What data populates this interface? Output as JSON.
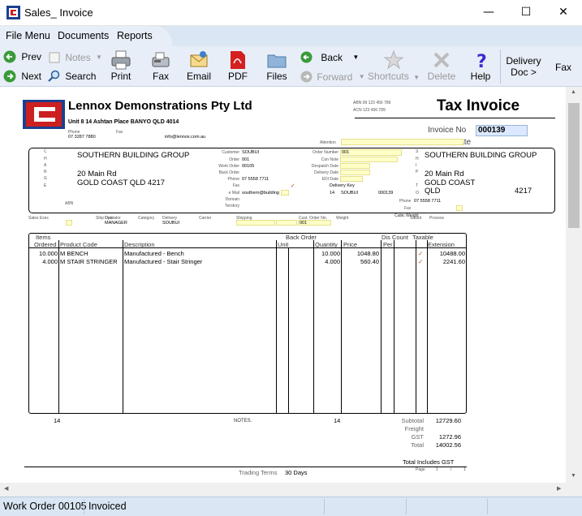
{
  "window": {
    "title": "Sales_ Invoice",
    "minimize": "—",
    "maximize": "☐",
    "close": "✕"
  },
  "menu": {
    "file": "File Menu",
    "documents": "Documents",
    "reports": "Reports"
  },
  "toolbar": {
    "prev": "Prev",
    "next": "Next",
    "notes": "Notes",
    "search": "Search",
    "print": "Print",
    "fax": "Fax",
    "email": "Email",
    "pdf": "PDF",
    "files": "Files",
    "back": "Back",
    "forward": "Forward",
    "shortcuts": "Shortcuts",
    "delete": "Delete",
    "help": "Help",
    "delivery_doc_line1": "Delivery",
    "delivery_doc_line2": "Doc >",
    "fax_right": "Fax"
  },
  "invoice": {
    "company": "Lennox Demonstrations Pty Ltd",
    "address": "Unit 8 14 Ashtan Place BANYO QLD 4014",
    "phone_label": "Phone",
    "phone": "07 3287 7880",
    "fax_label": "Fax",
    "email": "info@lennox.com.au",
    "abn": "ABN 99 123 456 789",
    "acn": "ACN 123 456 789",
    "doc_title": "Tax Invoice",
    "invoice_no_label": "Invoice No",
    "invoice_no": "000139",
    "date_label": "Date",
    "attention_label": "Attention",
    "charge_letters": [
      "C",
      "H",
      "A",
      "R",
      "G",
      "E"
    ],
    "ship_letters": [
      "S",
      "H",
      "I",
      "P",
      "T",
      "O"
    ],
    "bill_name": "SOUTHERN BUILDING GROUP",
    "bill_addr1": "20 Main Rd",
    "bill_addr2": "GOLD COAST QLD 4217",
    "abn_label": "ABN",
    "customer_label": "Customer",
    "customer": "SOUBUI",
    "order_label": "Order",
    "order": "001",
    "work_order_label": "Work Order",
    "work_order": "00105",
    "back_order_label": "Back Order",
    "phone2_label": "Phone",
    "phone2": "07 5558 7711",
    "fax2_label": "Fax",
    "email2_label": "e Mail",
    "email2": "southern@building",
    "domain_label": "Domain",
    "territory_label": "Territory",
    "order_number_label": "Order Number",
    "order_number": "001",
    "con_note_label": "Con Note",
    "despatch_label": "Despatch Date",
    "delivery_date_label": "Delivery Date",
    "edi_label": "EDI Date",
    "delivery_key_label": "Delivery Key",
    "dk_1": "14",
    "dk_2": "SOUBUI",
    "dk_3": "000139",
    "tick": "✓",
    "ship_name": "SOUTHERN BUILDING GROUP",
    "ship_addr1": "20 Main Rd",
    "ship_addr2": "GOLD COAST",
    "ship_addr3": "QLD",
    "ship_postcode": "4217",
    "ship_phone_label": "Phone",
    "ship_phone": "07 5558 7711",
    "ship_fax_label": "Fax",
    "sales_exec_label": "Sales Exec",
    "ship_date_label": "Ship Date",
    "operator_label": "Operator",
    "operator": "MANAGER",
    "category_label": "Category",
    "delivery_label": "Delivery",
    "delivery": "SOUBUI",
    "carrier_label": "Carrier",
    "shipping_label": "Shipping",
    "cust_order_label": "Cust. Order No.",
    "cust_order": "001",
    "weight_label": "Weight",
    "cubic_label": "Cubic Weight",
    "sublot_label": "Sublot",
    "process_label": "Process",
    "col_items": "Items",
    "col_ordered": "Ordered",
    "col_product": "Product Code",
    "col_description": "Description",
    "col_unit": "Unit",
    "col_back_order": "Back Order",
    "col_quantity": "Quantity",
    "col_price": "Price",
    "col_dis": "Dis Count",
    "col_per": "Per",
    "col_taxable": "Taxable",
    "col_extension": "Extension",
    "lines": [
      {
        "ordered": "10.000",
        "product": "M BENCH",
        "description": "Manufactured - Bench",
        "quantity": "10.000",
        "price": "1048.80",
        "taxable": "✓",
        "extension": "10488.00"
      },
      {
        "ordered": "4.000",
        "product": "M STAIR STRINGER",
        "description": "Manufactured - Stair Stringer",
        "quantity": "4.000",
        "price": "560.40",
        "taxable": "✓",
        "extension": "2241.60"
      }
    ],
    "total_items": "14",
    "notes_label": "NOTES.",
    "total_qty": "14",
    "subtotal_label": "Subtotal",
    "subtotal": "12729.60",
    "freight_label": "Freight",
    "gst_label": "GST",
    "gst": "1272.96",
    "total_label": "Total",
    "total": "14002.56",
    "includes_gst": "Total Includes GST",
    "trading_terms_label": "Trading Terms",
    "trading_terms": "30 Days",
    "page_label": "Page",
    "page_num": "1",
    "page_of": "1"
  },
  "status": {
    "work_order": "Work Order 00105",
    "state": "Invoiced"
  },
  "colors": {
    "accent_red": "#cc1f1f",
    "toolbar_bg": "#e8eef8",
    "menu_bg": "#dbe6f4",
    "field_yellow": "#ffffc8",
    "invoice_no_bg": "#dbe8ff"
  }
}
